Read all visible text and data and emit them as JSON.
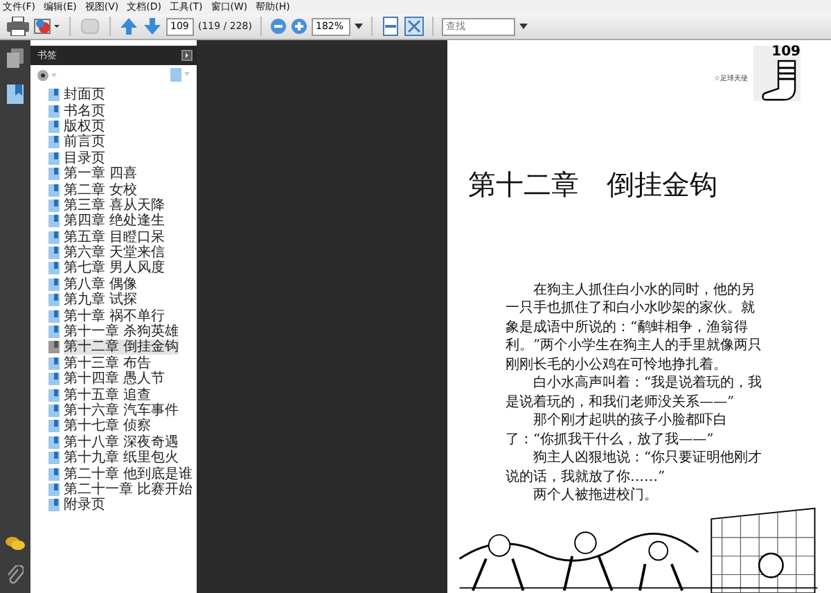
{
  "menu_bar": [
    "文件(F)",
    "编辑(E)",
    "视图(V)",
    "文档(D)",
    "工具(T)",
    "窗口(W)",
    "帮助(H)"
  ],
  "toolbar": {
    "page_number": "109",
    "page_count": "(119 / 228)",
    "zoom": "182%",
    "search": {
      "placeholder": "查找"
    }
  },
  "bookmarks_panel": {
    "title": "书签",
    "items": [
      {
        "label": "封面页",
        "selected": false
      },
      {
        "label": "书名页",
        "selected": false
      },
      {
        "label": "版权页",
        "selected": false
      },
      {
        "label": "前言页",
        "selected": false
      },
      {
        "label": "目录页",
        "selected": false
      },
      {
        "label": "第一章 四喜",
        "selected": false
      },
      {
        "label": "第二章 女校",
        "selected": false
      },
      {
        "label": "第三章 喜从天降",
        "selected": false
      },
      {
        "label": "第四章 绝处逢生",
        "selected": false
      },
      {
        "label": "第五章 目瞪口呆",
        "selected": false
      },
      {
        "label": "第六章 天堂来信",
        "selected": false
      },
      {
        "label": "第七章 男人风度",
        "selected": false
      },
      {
        "label": "第八章 偶像",
        "selected": false
      },
      {
        "label": "第九章 试探",
        "selected": false
      },
      {
        "label": "第十章 祸不单行",
        "selected": false
      },
      {
        "label": "第十一章 杀狗英雄",
        "selected": false
      },
      {
        "label": "第十二章 倒挂金钩",
        "selected": true
      },
      {
        "label": "第十三章 布告",
        "selected": false
      },
      {
        "label": "第十四章 愚人节",
        "selected": false
      },
      {
        "label": "第十五章 追查",
        "selected": false
      },
      {
        "label": "第十六章 汽车事件",
        "selected": false
      },
      {
        "label": "第十七章 侦察",
        "selected": false
      },
      {
        "label": "第十八章 深夜奇遇",
        "selected": false
      },
      {
        "label": "第十九章 纸里包火",
        "selected": false
      },
      {
        "label": "第二十章 他到底是谁",
        "selected": false
      },
      {
        "label": "第二十一章 比赛开始",
        "selected": false
      },
      {
        "label": "附录页",
        "selected": false
      }
    ]
  },
  "document_page": {
    "page_number": "109",
    "running_header": "☆足球天使",
    "chapter_title": "第十二章　倒挂金钩",
    "paragraphs": [
      "在狗主人抓住白小水的同时，他的另一只手也抓住了和白小水吵架的家伙。就象是成语中所说的：“鹬蚌相争，渔翁得利。”两个小学生在狗主人的手里就像两只刚刚长毛的小公鸡在可怜地挣扎着。",
      "白小水高声叫着：“我是说着玩的，我是说着玩的，和我们老师没关系——”",
      "那个刚才起哄的孩子小脸都吓白了：“你抓我干什么，放了我——”",
      "狗主人凶狠地说：“你只要证明他刚才说的话，我就放了你……”",
      "两个人被拖进校门。"
    ]
  }
}
